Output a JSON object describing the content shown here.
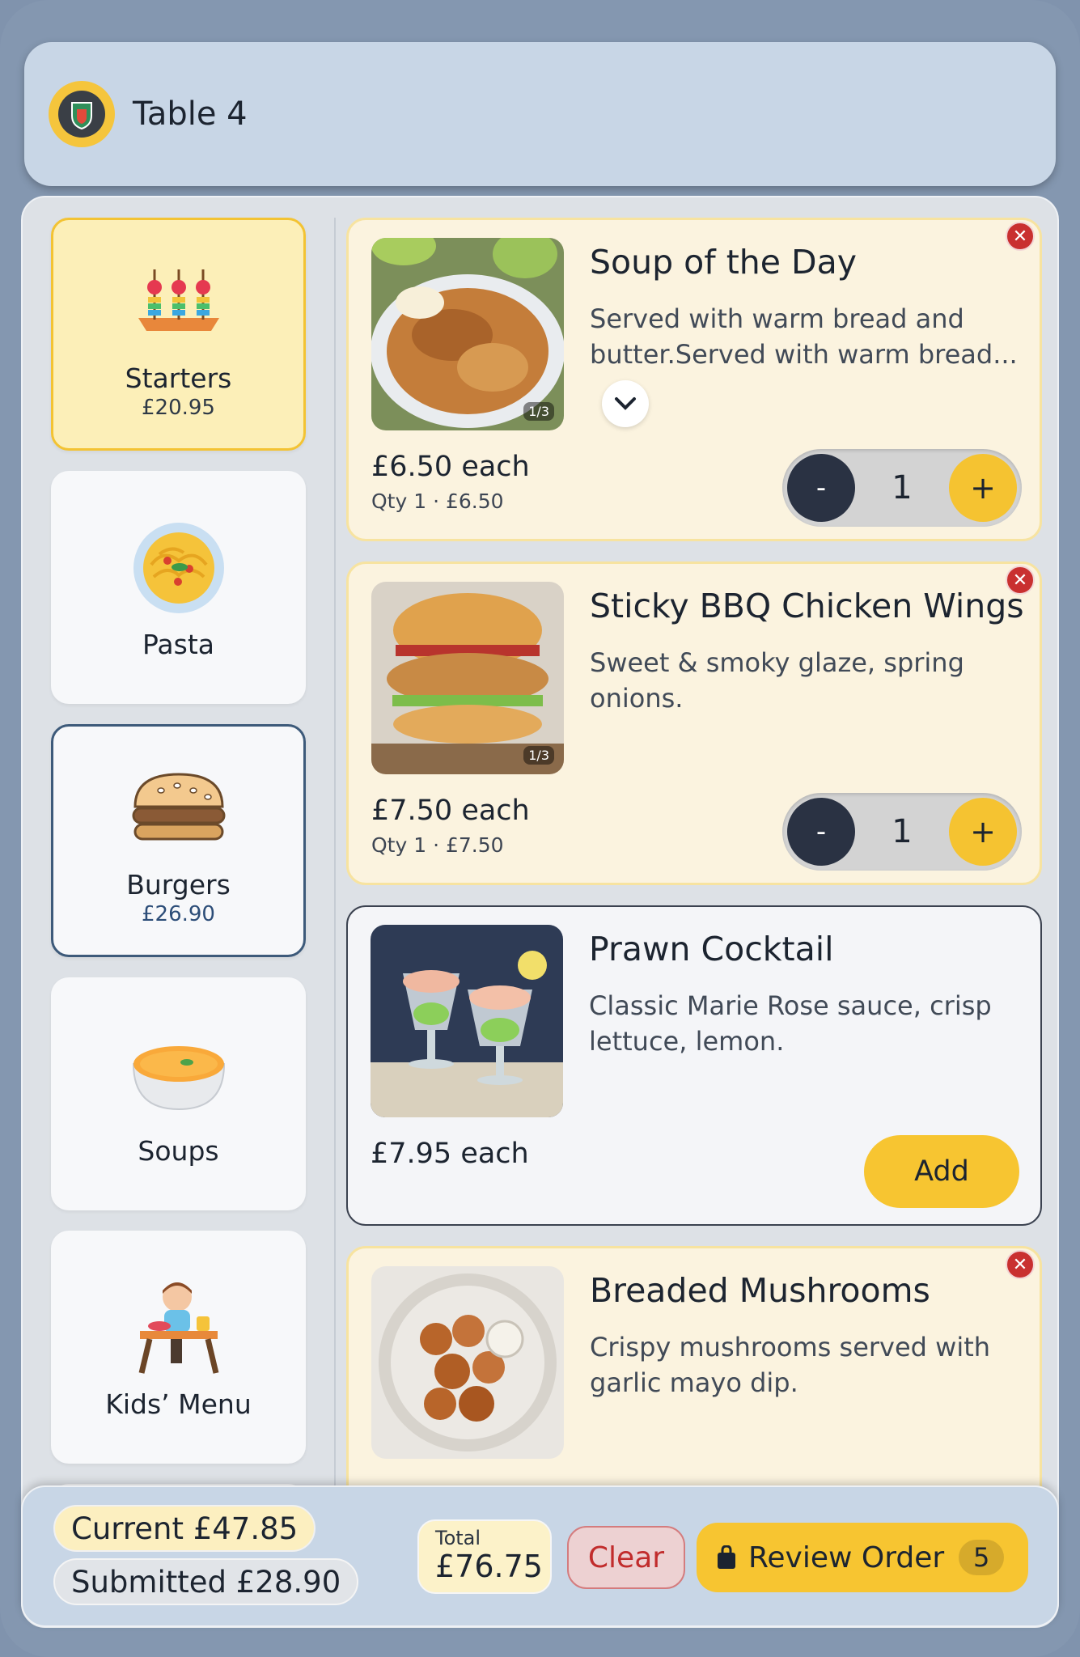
{
  "header": {
    "title": "Table 4"
  },
  "categories": [
    {
      "name": "Starters",
      "price": "£20.95",
      "state": "active",
      "icon": "skewers-icon"
    },
    {
      "name": "Pasta",
      "price": "",
      "state": "normal",
      "icon": "pasta-icon"
    },
    {
      "name": "Burgers",
      "price": "£26.90",
      "state": "selected",
      "icon": "burger-icon"
    },
    {
      "name": "Soups",
      "price": "",
      "state": "normal",
      "icon": "soup-bowl-icon"
    },
    {
      "name": "Kids’ Menu",
      "price": "",
      "state": "normal",
      "icon": "kid-meal-icon"
    }
  ],
  "items": [
    {
      "title": "Soup of the Day",
      "description": "Served with warm bread and butter.Served with warm bread...",
      "price_each": "£6.50 each",
      "qty_line": "Qty 1 · £6.50",
      "image_counter": "1/3",
      "quantity": "1",
      "in_cart": true
    },
    {
      "title": "Sticky BBQ Chicken Wings",
      "description": "Sweet & smoky glaze, spring onions.",
      "price_each": "£7.50 each",
      "qty_line": "Qty 1 · £7.50",
      "image_counter": "1/3",
      "quantity": "1",
      "in_cart": true
    },
    {
      "title": "Prawn Cocktail",
      "description": "Classic Marie Rose sauce, crisp lettuce, lemon.",
      "price_each": "£7.95 each",
      "add_label": "Add",
      "in_cart": false
    },
    {
      "title": "Breaded Mushrooms",
      "description": "Crispy mushrooms served with garlic mayo dip.",
      "in_cart": true
    }
  ],
  "stepper": {
    "minus": "-",
    "plus": "+"
  },
  "footer": {
    "current": "Current £47.85",
    "submitted": "Submitted £28.90",
    "total_label": "Total",
    "total_value": "£76.75",
    "clear_label": "Clear",
    "review_label": "Review Order",
    "review_count": "5"
  },
  "colors": {
    "accent": "#f7c531",
    "dark": "#2a3243",
    "danger": "#c12c2c",
    "selected_border": "#3d5a7a"
  }
}
